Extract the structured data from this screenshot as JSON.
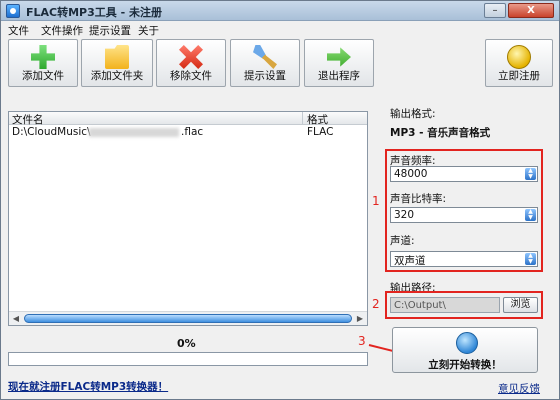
{
  "window": {
    "title": "FLAC转MP3工具 - 未注册",
    "close_label": "X"
  },
  "menu": [
    "文件",
    "文件操作",
    "提示设置",
    "关于"
  ],
  "toolbar": {
    "add_file": "添加文件",
    "add_folder": "添加文件夹",
    "remove_file": "移除文件",
    "prompt_settings": "提示设置",
    "exit": "退出程序",
    "register": "立即注册"
  },
  "file_list": {
    "columns": [
      "文件名",
      "格式"
    ],
    "rows": [
      {
        "path_prefix": "D:\\CloudMusic\\",
        "path_suffix": ".flac",
        "format": "FLAC"
      }
    ]
  },
  "progress": {
    "text": "0%",
    "value": 0
  },
  "output": {
    "format_label": "输出格式:",
    "format_value": "MP3 - 音乐声音格式",
    "sample_rate_label": "声音频率:",
    "sample_rate_value": "48000",
    "bitrate_label": "声音比特率:",
    "bitrate_value": "320",
    "channel_label": "声道:",
    "channel_value": "双声道",
    "path_label": "输出路径:",
    "path_value": "C:\\Output\\",
    "browse_label": "浏览"
  },
  "annotations": {
    "marker_1": "1",
    "marker_2": "2",
    "marker_3": "3"
  },
  "convert_button": "立刻开始转换！",
  "footer": {
    "register_link": "现在就注册FLAC转MP3转换器！",
    "feedback_link": "意见反馈"
  },
  "colors": {
    "annotation_red": "#e2241f",
    "scroll_blue": "#3f8fe0",
    "link_blue": "#0b2a8a"
  }
}
